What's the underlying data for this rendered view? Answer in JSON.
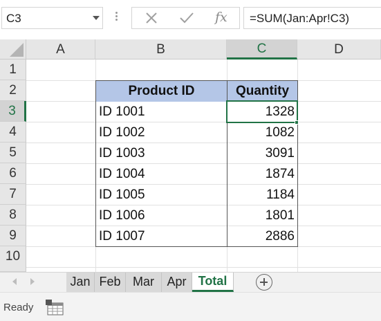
{
  "formula_bar": {
    "name_box": "C3",
    "cancel_icon": "x-icon",
    "enter_icon": "check-icon",
    "function_label": "fx",
    "formula": "=SUM(Jan:Apr!C3)"
  },
  "grid": {
    "columns": [
      "A",
      "B",
      "C",
      "D"
    ],
    "selected_column": "C",
    "rows": [
      "1",
      "2",
      "3",
      "4",
      "5",
      "6",
      "7",
      "8",
      "9",
      "10"
    ],
    "selected_row": "3",
    "selected_cell": "C3"
  },
  "table": {
    "headers": [
      "Product ID",
      "Quantity"
    ],
    "header_fill": "#b4c6e7",
    "rows": [
      {
        "id": "ID 1001",
        "qty": "1328"
      },
      {
        "id": "ID 1002",
        "qty": "1082"
      },
      {
        "id": "ID 1003",
        "qty": "3091"
      },
      {
        "id": "ID 1004",
        "qty": "1874"
      },
      {
        "id": "ID 1005",
        "qty": "1184"
      },
      {
        "id": "ID 1006",
        "qty": "1801"
      },
      {
        "id": "ID 1007",
        "qty": "2886"
      }
    ]
  },
  "sheet_tabs": {
    "tabs": [
      "Jan",
      "Feb",
      "Mar",
      "Apr",
      "Total"
    ],
    "active": "Total",
    "accent": "#217346"
  },
  "status_bar": {
    "state": "Ready",
    "macro_icon": "macro-record-icon"
  }
}
